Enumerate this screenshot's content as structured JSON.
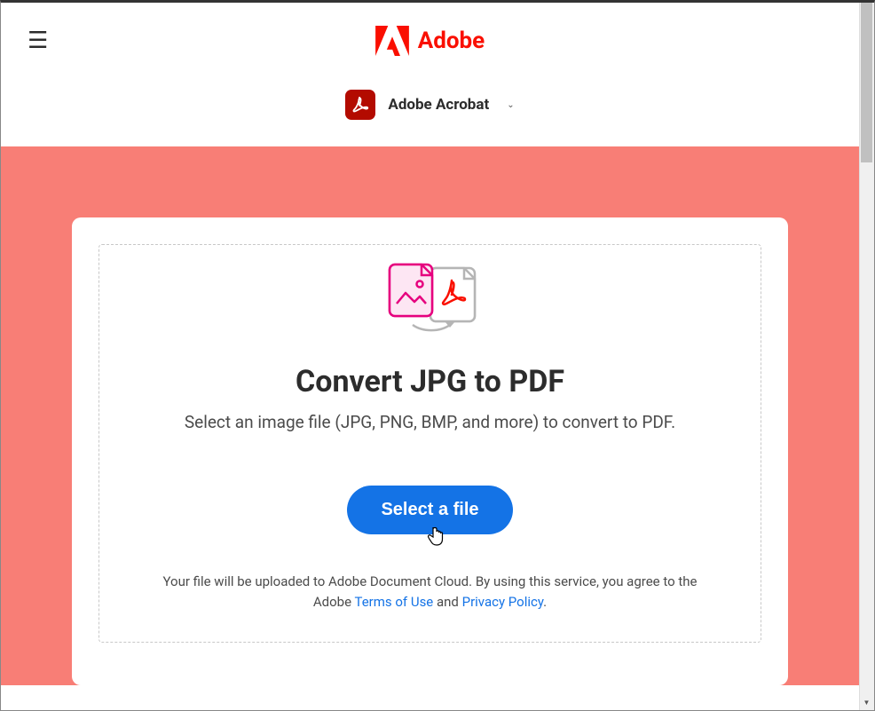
{
  "header": {
    "brand_name": "Adobe"
  },
  "subnav": {
    "product_name": "Adobe Acrobat"
  },
  "main": {
    "title": "Convert JPG to PDF",
    "subtitle": "Select an image file (JPG, PNG, BMP, and more) to convert to PDF.",
    "cta_label": "Select a file",
    "disclaimer_prefix": "Your file will be uploaded to Adobe Document Cloud.  By using this service, you agree to the Adobe ",
    "terms_link_text": "Terms of Use",
    "disclaimer_and": " and ",
    "privacy_link_text": "Privacy Policy",
    "disclaimer_suffix": "."
  }
}
